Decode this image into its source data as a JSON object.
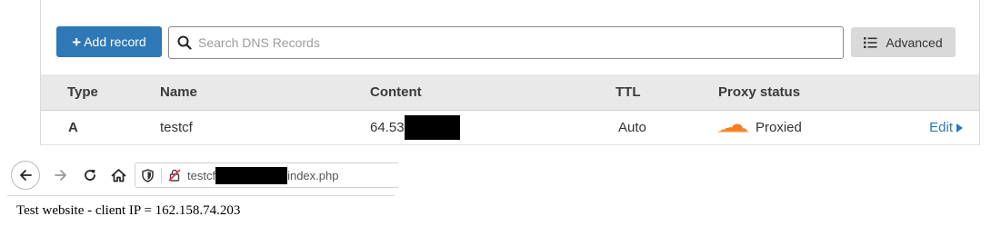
{
  "dns": {
    "add_button_label": "Add record",
    "add_button_icon": "plus-icon",
    "search_placeholder": "Search DNS Records",
    "advanced_button_label": "Advanced",
    "columns": [
      "Type",
      "Name",
      "Content",
      "TTL",
      "Proxy status"
    ],
    "record": {
      "type": "A",
      "name": "testcf",
      "content_visible": "64.53",
      "ttl": "Auto",
      "proxy_status": "Proxied",
      "edit_label": "Edit"
    },
    "colors": {
      "primary_button": "#2e78b6",
      "proxy_cloud": "#f38020",
      "header_bg": "#e9e9e9"
    }
  },
  "browser": {
    "url_prefix": "testcf",
    "url_suffix": "index.php",
    "icons": [
      "back-arrow-icon",
      "forward-arrow-icon",
      "reload-icon",
      "home-icon",
      "shield-icon",
      "insecure-lock-icon"
    ]
  },
  "page": {
    "text": "Test website - client IP = 162.158.74.203"
  }
}
